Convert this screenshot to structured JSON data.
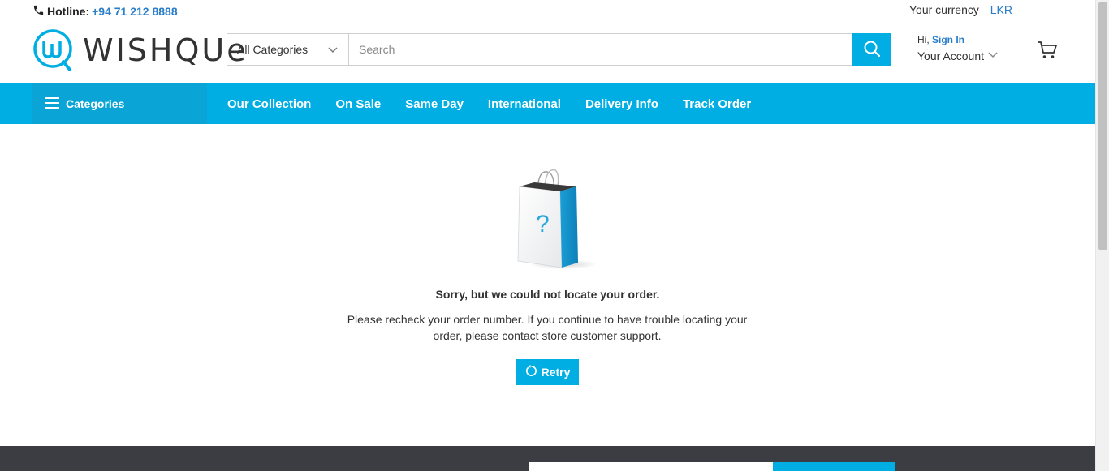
{
  "header": {
    "hotline_label": "Hotline:",
    "hotline_number": "+94 71 212 8888",
    "currency_label": "Your currency",
    "currency_code": "LKR",
    "logo_text": "WISHQUe"
  },
  "search": {
    "category": "All Categories",
    "placeholder": "Search"
  },
  "account": {
    "greeting": "Hi,",
    "sign_in": "Sign In",
    "label": "Your Account"
  },
  "nav": {
    "categories_label": "Categories",
    "links": [
      "Our Collection",
      "On Sale",
      "Same Day",
      "International",
      "Delivery Info",
      "Track Order"
    ]
  },
  "main": {
    "title": "Sorry, but we could not locate your order.",
    "body": "Please recheck your order number. If you continue to have trouble locating your order, please contact store customer support.",
    "retry_label": "Retry"
  },
  "colors": {
    "accent": "#00aee3",
    "link": "#2a7dc8",
    "footer": "#3b3d42"
  },
  "icons": [
    "phone-icon",
    "search-icon",
    "chevron-down-icon",
    "cart-icon",
    "menu-icon",
    "shopping-bag-icon",
    "refresh-icon"
  ]
}
